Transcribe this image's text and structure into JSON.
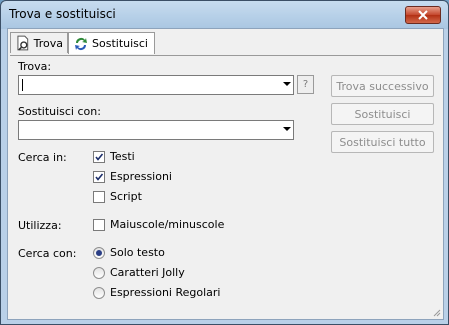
{
  "window": {
    "title": "Trova e sostituisci"
  },
  "tabs": [
    {
      "label": "Trova",
      "icon": "find-doc-icon"
    },
    {
      "label": "Sostituisci",
      "icon": "replace-arrows-icon",
      "active": true
    }
  ],
  "find": {
    "label": "Trova:",
    "value": "",
    "help": "?"
  },
  "replace": {
    "label": "Sostituisci con:",
    "value": ""
  },
  "buttons": {
    "find_next": "Trova successivo",
    "replace": "Sostituisci",
    "replace_all": "Sostituisci tutto"
  },
  "search_in": {
    "label": "Cerca in:",
    "options": [
      {
        "label": "Testi",
        "checked": true
      },
      {
        "label": "Espressioni",
        "checked": true
      },
      {
        "label": "Script",
        "checked": false
      }
    ]
  },
  "use": {
    "label": "Utilizza:",
    "options": [
      {
        "label": "Maiuscole/minuscole",
        "checked": false
      }
    ]
  },
  "search_with": {
    "label": "Cerca con:",
    "options": [
      {
        "label": "Solo testo",
        "selected": true
      },
      {
        "label": "Caratteri Jolly",
        "selected": false
      },
      {
        "label": "Espressioni Regolari",
        "selected": false
      }
    ]
  }
}
